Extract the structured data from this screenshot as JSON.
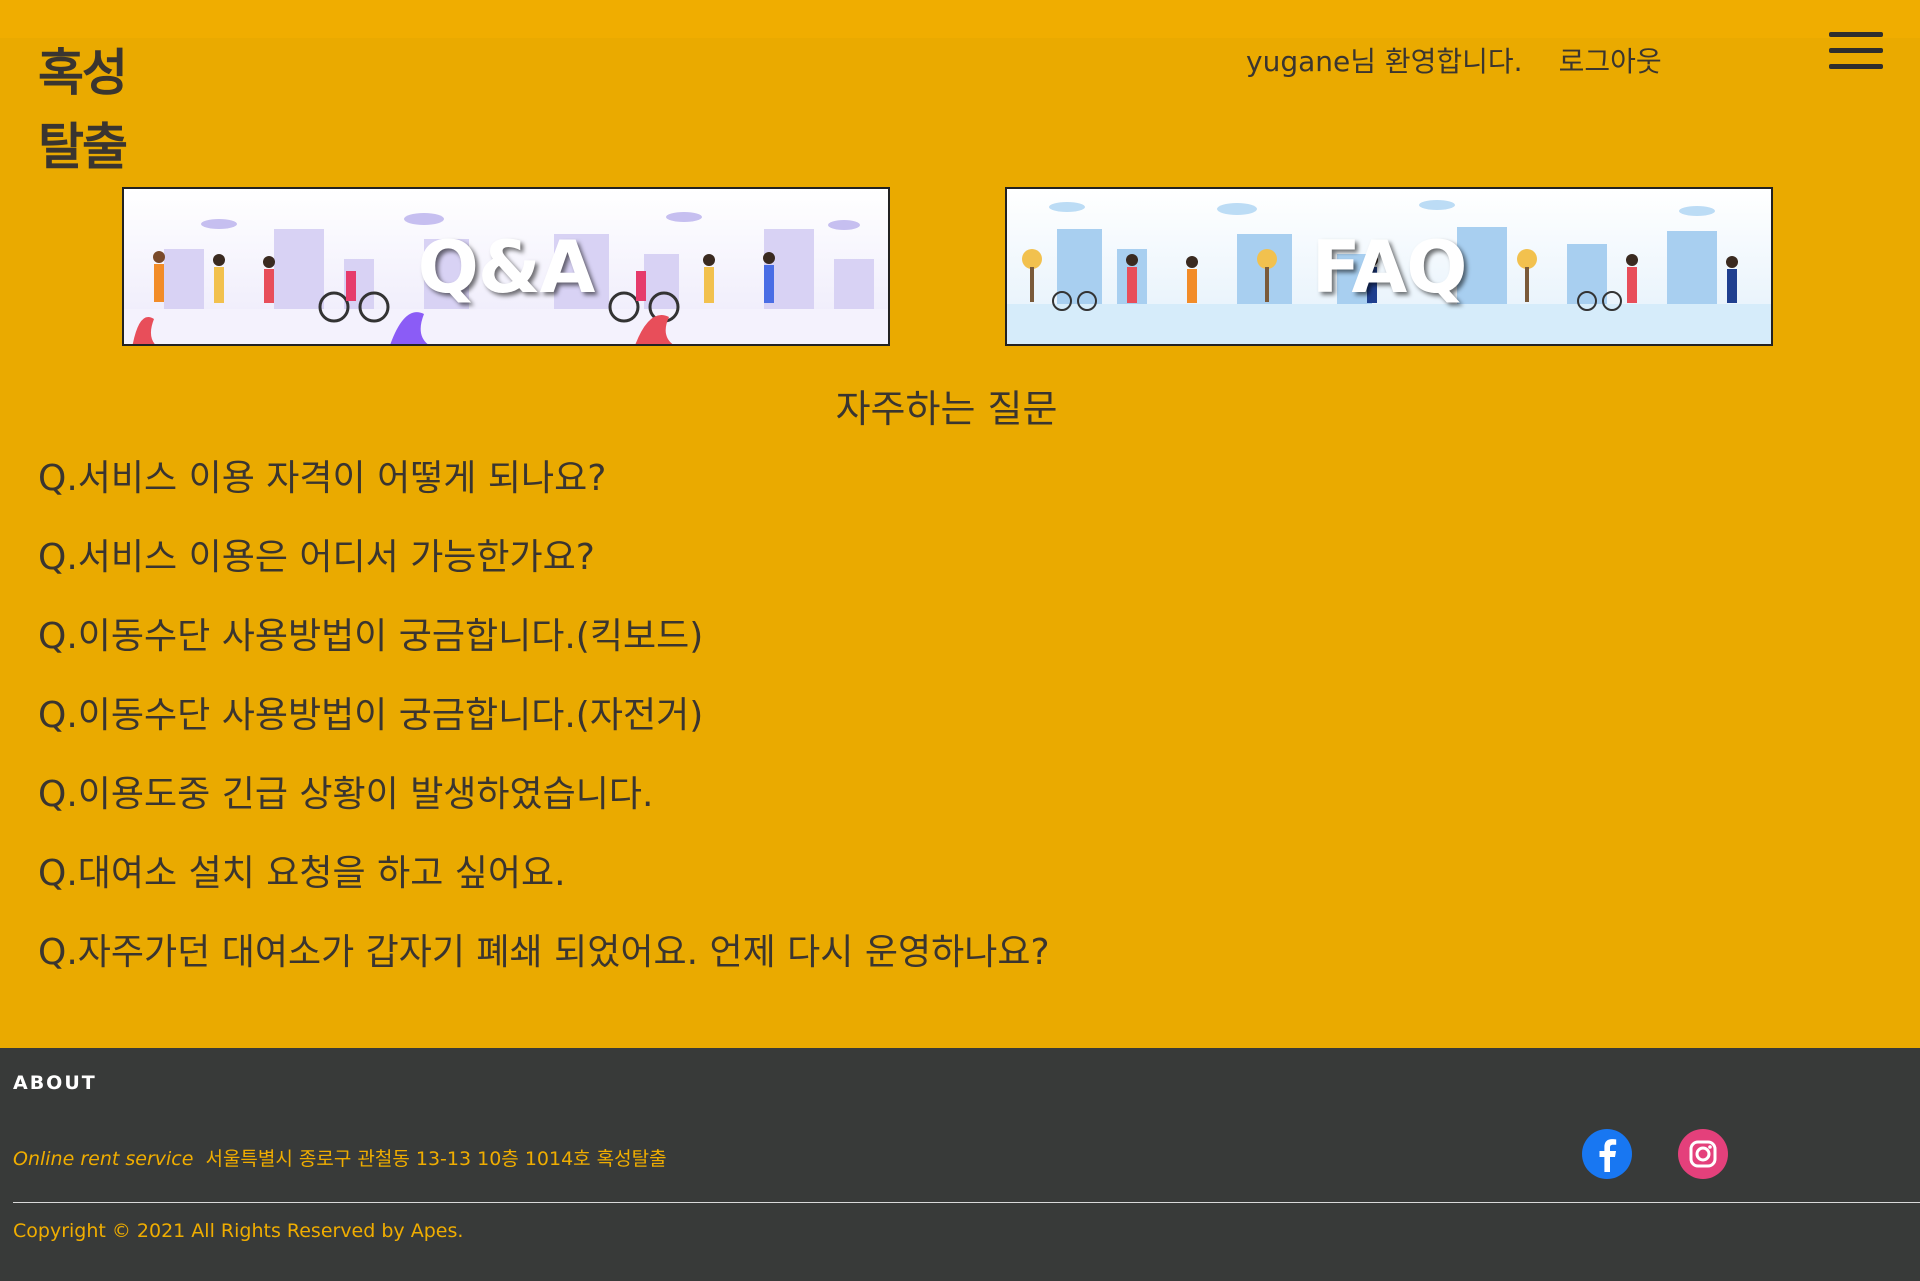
{
  "header": {
    "logo_line1": "혹성",
    "logo_line2": "탈출",
    "welcome": "yugane님 환영합니다.",
    "logout": "로그아웃"
  },
  "banners": {
    "qa_title": "Q&A",
    "faq_title": "FAQ"
  },
  "faq": {
    "heading": "자주하는 질문",
    "questions": [
      "Q.서비스 이용 자격이 어떻게 되나요?",
      "Q.서비스 이용은 어디서 가능한가요?",
      "Q.이동수단 사용방법이 궁금합니다.(킥보드)",
      "Q.이동수단 사용방법이 궁금합니다.(자전거)",
      "Q.이용도중 긴급 상황이 발생하였습니다.",
      "Q.대여소 설치 요청을 하고 싶어요.",
      "Q.자주가던 대여소가 갑자기 폐쇄 되었어요. 언제 다시 운영하나요?"
    ]
  },
  "footer": {
    "about": "ABOUT",
    "service_label": "Online rent service",
    "address": "서울특별시 종로구 관철동 13-13 10층 1014호 혹성탈출",
    "copyright": "Copyright © 2021 All Rights Reserved by Apes."
  },
  "colors": {
    "background": "#eaaa00",
    "accent": "#f0ad00",
    "footer_bg": "#383a39",
    "facebook": "#1877f2",
    "instagram": "#e4407b"
  },
  "icons": {
    "menu": "hamburger-menu-icon",
    "facebook": "facebook-icon",
    "instagram": "instagram-icon"
  }
}
